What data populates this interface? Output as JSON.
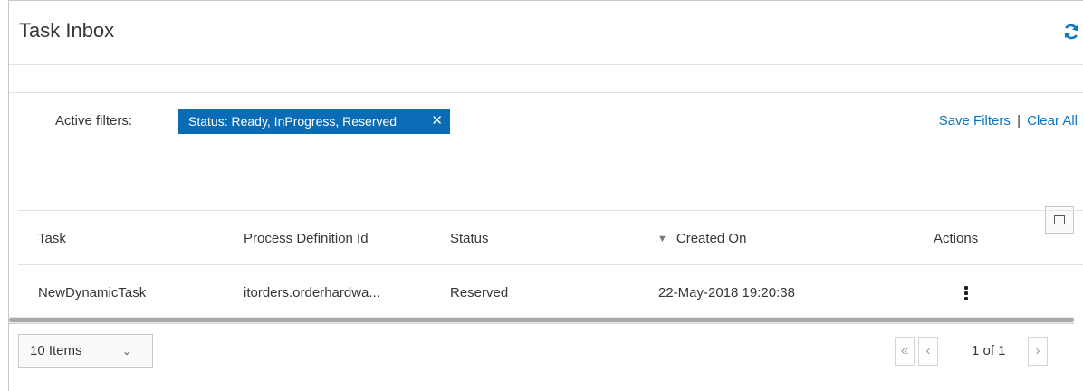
{
  "header": {
    "title": "Task Inbox",
    "refresh_icon": "refresh-icon"
  },
  "filters": {
    "label": "Active filters:",
    "chip_text": "Status: Ready, InProgress, Reserved",
    "chip_close": "✕",
    "save_label": "Save Filters",
    "separator": "|",
    "clear_label": "Clear All"
  },
  "table": {
    "columns": [
      "Task",
      "Process Definition Id",
      "Status",
      "Created On",
      "Actions"
    ],
    "sort_icon": "▼",
    "rows": [
      {
        "task": "NewDynamicTask",
        "process_def": "itorders.orderhardwa...",
        "status": "Reserved",
        "created_on": "22-May-2018 19:20:38"
      }
    ]
  },
  "pagination": {
    "items_per_page": "10 Items",
    "chevron": "⌄",
    "first": "«",
    "prev": "‹",
    "page_info": "1 of 1",
    "next": "›"
  },
  "colors": {
    "accent": "#0b6cb6",
    "link": "#0b76c2"
  }
}
